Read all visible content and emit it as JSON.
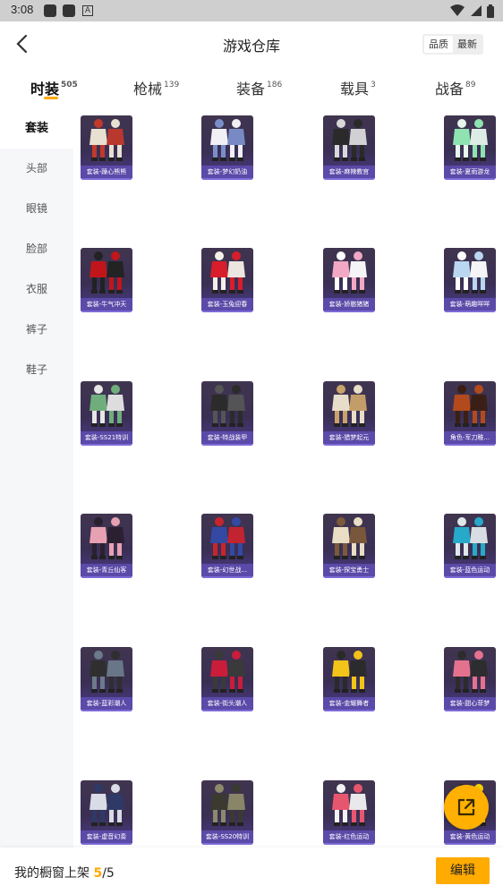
{
  "status_bar": {
    "time": "3:08",
    "icons": [
      "notification-square-icon",
      "notification-square-icon",
      "app-a-icon",
      "wifi-icon",
      "signal-icon",
      "battery-icon"
    ]
  },
  "header": {
    "title": "游戏仓库",
    "sort_options": [
      "品质",
      "最新"
    ],
    "sort_active": "品质"
  },
  "tabs": [
    {
      "label": "时装",
      "count": "505",
      "active": true
    },
    {
      "label": "枪械",
      "count": "139",
      "active": false
    },
    {
      "label": "装备",
      "count": "186",
      "active": false
    },
    {
      "label": "载具",
      "count": "3",
      "active": false
    },
    {
      "label": "战备",
      "count": "89",
      "active": false
    }
  ],
  "sidebar": {
    "items": [
      {
        "label": "套装",
        "active": true
      },
      {
        "label": "头部",
        "active": false
      },
      {
        "label": "眼镜",
        "active": false
      },
      {
        "label": "脸部",
        "active": false
      },
      {
        "label": "衣服",
        "active": false
      },
      {
        "label": "裤子",
        "active": false
      },
      {
        "label": "鞋子",
        "active": false
      }
    ]
  },
  "items": [
    {
      "label": "套装-躁心熊熊",
      "colors": [
        "#e8e0d0",
        "#c0392b"
      ]
    },
    {
      "label": "套装-梦幻奶油",
      "colors": [
        "#f0f0f5",
        "#7a8fc9"
      ]
    },
    {
      "label": "套装-麻辣教官",
      "colors": [
        "#2a2a2a",
        "#d9d9d9"
      ]
    },
    {
      "label": "套装-夏雨游龙",
      "colors": [
        "#8ee3b0",
        "#e7f7ee"
      ]
    },
    {
      "label": "套装-牛气冲天",
      "colors": [
        "#c0161b",
        "#222222"
      ]
    },
    {
      "label": "套装-玉兔迎春",
      "colors": [
        "#d81e2a",
        "#f4f0e8"
      ]
    },
    {
      "label": "套装-娇憨猪猪",
      "colors": [
        "#f2a8c5",
        "#ffffff"
      ]
    },
    {
      "label": "套装-萌趣咩咩",
      "colors": [
        "#b9d7f0",
        "#ffffff"
      ]
    },
    {
      "label": "套装-SS21特训",
      "colors": [
        "#6fae7c",
        "#e6e6e6"
      ]
    },
    {
      "label": "套装-特战装甲",
      "colors": [
        "#2b2b2b",
        "#555555"
      ]
    },
    {
      "label": "套装-猎梦起元",
      "colors": [
        "#e8ddc8",
        "#c9a36a"
      ]
    },
    {
      "label": "角色-军刀稚...",
      "colors": [
        "#b34a1c",
        "#3a1f14"
      ]
    },
    {
      "label": "套装-青丘仙客",
      "colors": [
        "#e8a1b2",
        "#2a2030"
      ]
    },
    {
      "label": "套装-幻世战...",
      "colors": [
        "#3349a3",
        "#c8242e"
      ]
    },
    {
      "label": "套装-探宝勇士",
      "colors": [
        "#e9ddc4",
        "#7b5a3a"
      ]
    },
    {
      "label": "套装-蓝色运动",
      "colors": [
        "#27a9c9",
        "#dfe7ea"
      ]
    },
    {
      "label": "套装-蓝彩潮人",
      "colors": [
        "#2f2f2f",
        "#6c7a8a"
      ]
    },
    {
      "label": "套装-街头潮人",
      "colors": [
        "#c91d3a",
        "#3a3a3a"
      ]
    },
    {
      "label": "套装-金耀舞者",
      "colors": [
        "#f2c318",
        "#2a2a2a"
      ]
    },
    {
      "label": "套装-甜心菲梦",
      "colors": [
        "#e4728e",
        "#2c2c2c"
      ]
    },
    {
      "label": "套装-虚音幻奏",
      "colors": [
        "#d9dbe6",
        "#2d3a66"
      ]
    },
    {
      "label": "套装-SS20特训",
      "colors": [
        "#3a3a30",
        "#8c8a6a"
      ]
    },
    {
      "label": "套装-红色运动",
      "colors": [
        "#e7566f",
        "#f2f2f2"
      ]
    },
    {
      "label": "套装-黄色运动",
      "colors": [
        "#f5d300",
        "#2a2a2a"
      ]
    }
  ],
  "footer": {
    "label": "我的橱窗上架",
    "current": "5",
    "separator": "/",
    "total": "5",
    "edit_label": "编辑"
  },
  "fab": {
    "icon": "share-icon"
  }
}
